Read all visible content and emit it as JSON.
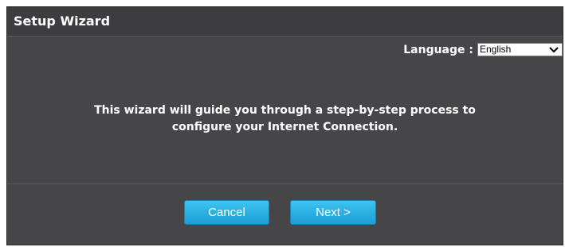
{
  "header": {
    "title": "Setup Wizard"
  },
  "language": {
    "label": "Language :",
    "selected": "English"
  },
  "message": {
    "line1": "This wizard will guide you through a step-by-step process to",
    "line2": "configure your Internet Connection."
  },
  "buttons": {
    "cancel": "Cancel",
    "next": "Next >"
  },
  "colors": {
    "panel": "#464649",
    "button_accent": "#29b2e6"
  },
  "icons": {
    "dropdown": "chevron-down-icon"
  }
}
